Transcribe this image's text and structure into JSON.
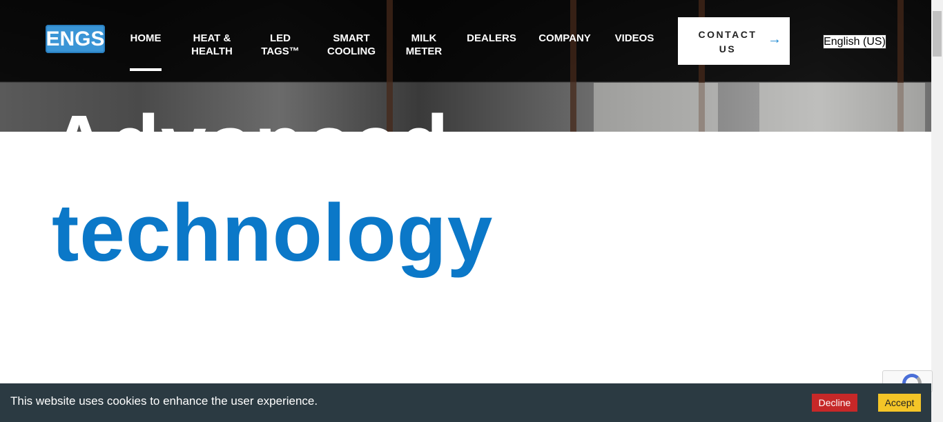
{
  "header": {
    "logo_text": "ENGS",
    "nav": [
      {
        "label": "HOME",
        "active": true
      },
      {
        "label": "HEAT &\nHEALTH"
      },
      {
        "label": "LED\nTAGS™"
      },
      {
        "label": "SMART\nCOOLING"
      },
      {
        "label": "MILK\nMETER"
      },
      {
        "label": "DEALERS"
      },
      {
        "label": "COMPANY"
      },
      {
        "label": "VIDEOS"
      }
    ],
    "contact_label": "CONTACT US",
    "contact_arrow": "→",
    "language": "English (US)"
  },
  "hero": {
    "partial_heading": "Advanced",
    "heading_word": "technology"
  },
  "cookie_bar": {
    "message": "This website uses cookies to enhance the user experience.",
    "decline_label": "Decline",
    "accept_label": "Accept"
  },
  "colors": {
    "brand_blue": "#0b78c8",
    "decline_red": "#c62828",
    "accept_yellow": "#f4c527",
    "cookie_bg": "#2b3a42"
  }
}
